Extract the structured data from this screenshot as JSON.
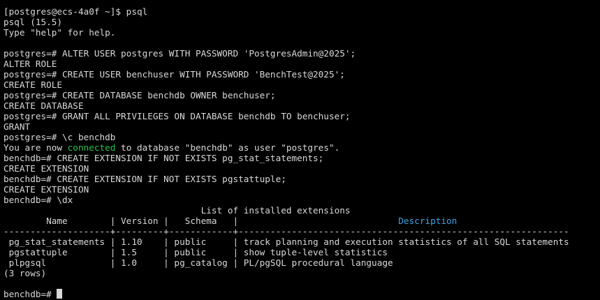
{
  "terminal": {
    "partial_top_line": "                                     ",
    "shell_prompt": "[postgres@ecs-4a0f ~]$ psql",
    "psql_version": "psql (15.5)",
    "help_hint": "Type \"help\" for help.",
    "cmd1": "postgres=# ALTER USER postgres WITH PASSWORD 'PostgresAdmin@2025';",
    "out1": "ALTER ROLE",
    "cmd2": "postgres=# CREATE USER benchuser WITH PASSWORD 'BenchTest@2025';",
    "out2": "CREATE ROLE",
    "cmd3": "postgres=# CREATE DATABASE benchdb OWNER benchuser;",
    "out3": "CREATE DATABASE",
    "cmd4": "postgres=# GRANT ALL PRIVILEGES ON DATABASE benchdb TO benchuser;",
    "out4": "GRANT",
    "cmd5": "postgres=# \\c benchdb",
    "connect_msg_before": "You are now ",
    "connect_msg_keyword": "connected",
    "connect_msg_after": " to database \"benchdb\" as user \"postgres\".",
    "cmd6": "benchdb=# CREATE EXTENSION IF NOT EXISTS pg_stat_statements;",
    "out6": "CREATE EXTENSION",
    "cmd7": "benchdb=# CREATE EXTENSION IF NOT EXISTS pgstattuple;",
    "out7": "CREATE EXTENSION",
    "cmd8": "benchdb=# \\dx",
    "table_title": "                                     List of installed extensions",
    "header_left": "        Name        | Version |   Schema   |                              ",
    "header_description": "Description",
    "header_separator": "--------------------+---------+------------+--------------------------------------------------------------",
    "rows": [
      " pg_stat_statements | 1.10    | public     | track planning and execution statistics of all SQL statements",
      " pgstattuple        | 1.5     | public     | show tuple-level statistics",
      " plpgsql            | 1.0     | pg_catalog | PL/pgSQL procedural language"
    ],
    "row_count": "(3 rows)",
    "final_prompt": "benchdb=# "
  },
  "colors": {
    "background": "#000000",
    "text": "#d9d9d9",
    "keyword_green": "#27c24c",
    "header_cyan": "#3ba5e8"
  }
}
